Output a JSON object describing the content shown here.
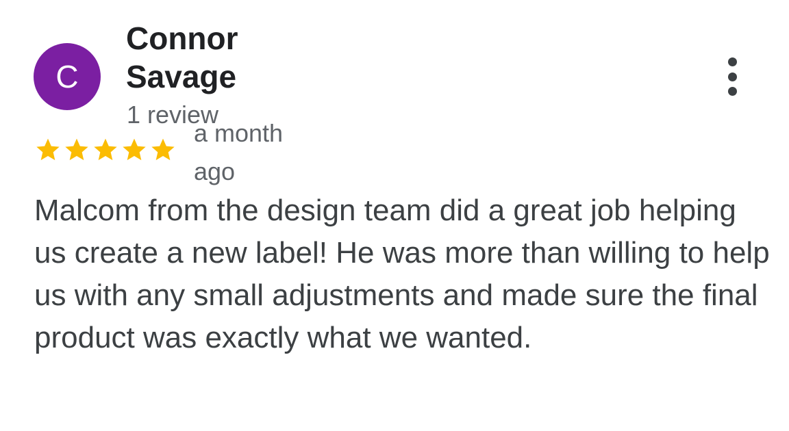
{
  "reviewer": {
    "initial": "C",
    "name": "Connor Savage",
    "review_count": "1 review",
    "avatar_color": "#7b1fa2"
  },
  "review": {
    "rating": 5,
    "rating_max": 5,
    "star_color": "#fbbc04",
    "date": "a month ago",
    "text": "Malcom from the design team did a great job helping us create a new label! He was more than willing to help us with any small adjustments and made sure the final product was exactly what we wanted."
  },
  "icons": {
    "more": "more-vertical-icon",
    "star": "star-icon"
  }
}
